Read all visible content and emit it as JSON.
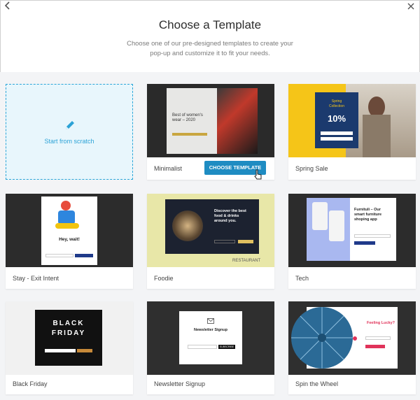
{
  "header": {
    "back_icon": "chevron-left-icon",
    "close_icon": "close-icon",
    "title": "Choose a Template",
    "subtitle_line1": "Choose one of our pre-designed templates to create your",
    "subtitle_line2": "pop-up and customize it to fit your needs."
  },
  "scratch": {
    "label": "Start from scratch",
    "icon": "pencil-icon"
  },
  "choose_button": "CHOOSE TEMPLATE",
  "templates": [
    {
      "name": "Minimalist",
      "heading": "Best of women's wear – 2020"
    },
    {
      "name": "Spring Sale",
      "heading_top": "Spring",
      "heading_bottom": "Collection",
      "discount": "10%"
    },
    {
      "name": "Stay - Exit Intent",
      "heading": "Hey, wait!"
    },
    {
      "name": "Foodie",
      "heading_l1": "Discover the best",
      "heading_l2": "food & drinks",
      "heading_l3": "around you.",
      "footer": "RESTAURANT"
    },
    {
      "name": "Tech",
      "heading_l1": "Furnituli – Our",
      "heading_l2": "smart furniture",
      "heading_l3": "shoping app"
    },
    {
      "name": "Black Friday",
      "line1": "BLACK",
      "line2": "FRIDAY"
    },
    {
      "name": "Newsletter Signup",
      "heading": "Newsletter Signup",
      "button": "SUBSCRIBE"
    },
    {
      "name": "Spin the Wheel",
      "heading": "Feeling Lucky?"
    }
  ],
  "colors": {
    "accent": "#1f8cc2",
    "scratch_text": "#2ba2d6",
    "spring_yellow": "#f5c518",
    "spring_blue": "#1b3a6e",
    "wheel_blue": "#2b6a96",
    "lucky_red": "#e0335a"
  }
}
